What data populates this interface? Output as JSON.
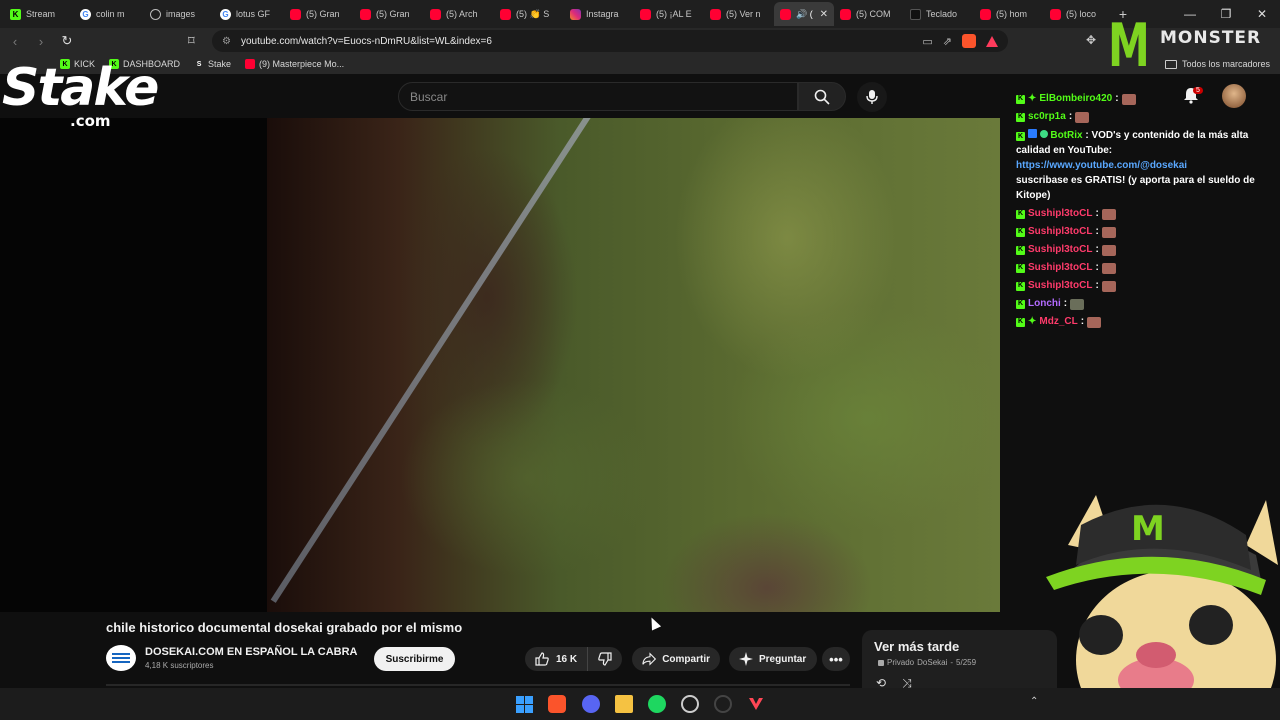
{
  "tabs": [
    {
      "label": "Stream",
      "favicon": "kick"
    },
    {
      "label": "colin m",
      "favicon": "google"
    },
    {
      "label": "images",
      "favicon": "globe"
    },
    {
      "label": "lotus GF",
      "favicon": "google"
    },
    {
      "label": "(5) Gran",
      "favicon": "youtube"
    },
    {
      "label": "(5) Gran",
      "favicon": "youtube"
    },
    {
      "label": "(5) Arch",
      "favicon": "youtube"
    },
    {
      "label": "(5) 👏 S",
      "favicon": "youtube"
    },
    {
      "label": "Instagra",
      "favicon": "instagram"
    },
    {
      "label": "(5) ¡AL E",
      "favicon": "youtube"
    },
    {
      "label": "(5) Ver n",
      "favicon": "youtube"
    },
    {
      "label": "🔊 (",
      "favicon": "youtube",
      "active": true
    },
    {
      "label": "(5) COM",
      "favicon": "youtube"
    },
    {
      "label": "Teclado",
      "favicon": "dark"
    },
    {
      "label": "(5) hom",
      "favicon": "youtube"
    },
    {
      "label": "(5) loco",
      "favicon": "youtube"
    }
  ],
  "address": {
    "url": "youtube.com/watch?v=Euocs-nDmRU&list=WL&index=6"
  },
  "bookmarks": [
    {
      "label": "KICK",
      "favicon": "kick"
    },
    {
      "label": "DASHBOARD",
      "favicon": "kick"
    },
    {
      "label": "Stake",
      "favicon": "stake"
    },
    {
      "label": "(9) Masterpiece Mo...",
      "favicon": "youtube"
    }
  ],
  "all_bookmarks_label": "Todos los marcadores",
  "youtube": {
    "search_placeholder": "Buscar",
    "notifications_count": "5",
    "video_title": "chile historico documental dosekai grabado por el mismo",
    "channel_name": "DOSEKAI.COM EN ESPAÑOL LA CABRA",
    "subscribers": "4,18 K suscriptores",
    "subscribe_label": "Suscribirme",
    "likes": "16 K",
    "share_label": "Compartir",
    "ask_label": "Preguntar",
    "playlist": {
      "title": "Ver más tarde",
      "privacy": "Privado",
      "owner": "DoSekai",
      "position": "5/259"
    }
  },
  "overlay": {
    "stake_logo_text": "Stake",
    "stake_logo_domain": ".com",
    "monster_logo_text": "MONSTER"
  },
  "chat": [
    {
      "user": "ElBombeiro420",
      "color": "#53fc18",
      "message": "",
      "emote": "face"
    },
    {
      "user": "sc0rp1a",
      "color": "#53fc18",
      "message": "",
      "emote": "face"
    },
    {
      "user": "BotRix",
      "color": "#53fc18",
      "message": "VOD's y contenido de la más alta calidad en YouTube:",
      "link": "https://www.youtube.com/@dosekai",
      "tail": "suscribase es GRATIS! (y aporta para el sueldo de Kitope)"
    },
    {
      "user": "Sushipl3toCL",
      "color": "#ff3b6b",
      "message": "",
      "emote": "face"
    },
    {
      "user": "Sushipl3toCL",
      "color": "#ff3b6b",
      "message": "",
      "emote": "face"
    },
    {
      "user": "Sushipl3toCL",
      "color": "#ff3b6b",
      "message": "",
      "emote": "face"
    },
    {
      "user": "Sushipl3toCL",
      "color": "#ff3b6b",
      "message": "",
      "emote": "face"
    },
    {
      "user": "Sushipl3toCL",
      "color": "#ff3b6b",
      "message": "",
      "emote": "face"
    },
    {
      "user": "Lonchi",
      "color": "#b36bff",
      "message": "",
      "emote": "tank"
    },
    {
      "user": "Mdz_CL",
      "color": "#ff3b6b",
      "message": "",
      "emote": "face"
    }
  ],
  "colors": {
    "kick_green": "#53fc18",
    "youtube_red": "#ff0033",
    "monster_green": "#7ed321"
  }
}
